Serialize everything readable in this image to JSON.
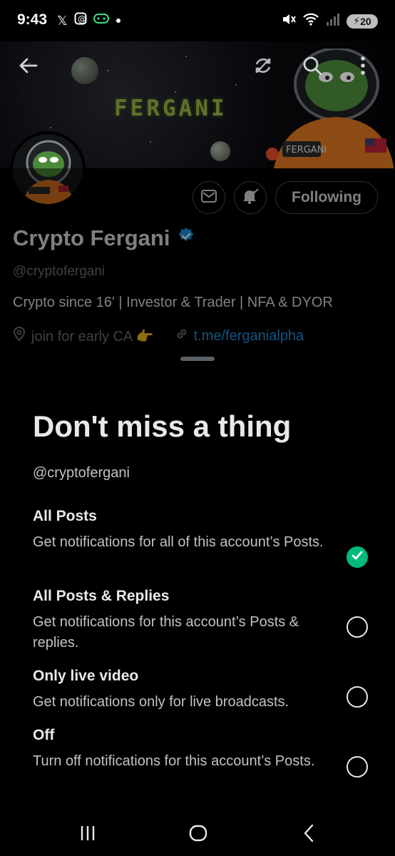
{
  "status_bar": {
    "time": "9:43",
    "left_icons": [
      "x-logo-icon",
      "threads-icon",
      "gamepad-icon",
      "dot-icon"
    ],
    "right_icons": [
      "mute-icon",
      "wifi-icon",
      "signal-icon"
    ],
    "battery": "20"
  },
  "banner": {
    "title": "FERGANI",
    "icons": [
      "back-arrow-icon",
      "sync-icon",
      "search-icon",
      "more-vertical-icon"
    ]
  },
  "profile": {
    "name": "Crypto Fergani",
    "verified_icon": "verified-badge-icon",
    "handle": "@cryptofergani",
    "bio": "Crypto since 16' | Investor & Trader | NFA & DYOR",
    "location": "join for early CA 👉",
    "link": "t.me/ferganialpha",
    "following_label": "Following",
    "actions": [
      "message-icon",
      "bell-checked-icon"
    ]
  },
  "sheet": {
    "title": "Don't miss a thing",
    "subtitle": "@cryptofergani",
    "options": [
      {
        "title": "All Posts",
        "description": "Get notifications for all of this account’s Posts.",
        "selected": true
      },
      {
        "title": "All Posts & Replies",
        "description": "Get notifications for this account’s Posts & replies.",
        "selected": false
      },
      {
        "title": "Only live video",
        "description": "Get notifications only for live broadcasts.",
        "selected": false
      },
      {
        "title": "Off",
        "description": "Turn off notifications for this account’s Posts.",
        "selected": false
      }
    ]
  },
  "nav": {
    "icons": [
      "recent-apps-icon",
      "home-icon",
      "back-icon"
    ]
  },
  "colors": {
    "background": "#000000",
    "accent_link": "#1d9bf0",
    "selected": "#00ba7c",
    "verified": "#1d9bf0"
  }
}
